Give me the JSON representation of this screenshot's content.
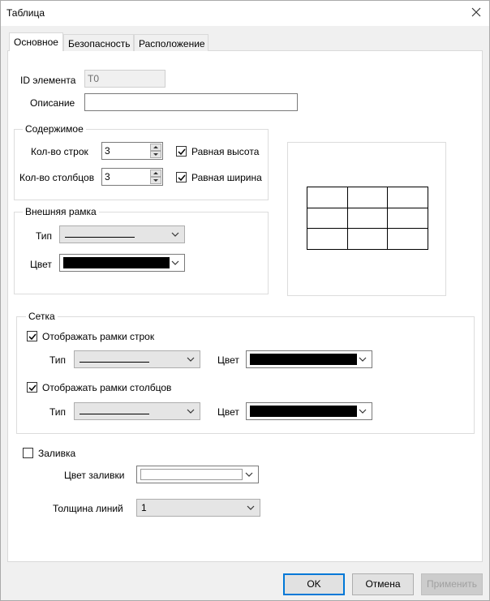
{
  "window": {
    "title": "Таблица"
  },
  "tabs": [
    {
      "label": "Основное",
      "active": true
    },
    {
      "label": "Безопасность",
      "active": false
    },
    {
      "label": "Расположение",
      "active": false
    }
  ],
  "element_id": {
    "label": "ID элемента",
    "value": "T0"
  },
  "description": {
    "label": "Описание",
    "value": ""
  },
  "content": {
    "legend": "Содержимое",
    "rows": {
      "label": "Кол-во строк",
      "value": "3"
    },
    "cols": {
      "label": "Кол-во столбцов",
      "value": "3"
    },
    "equal_height": {
      "label": "Равная высота",
      "checked": true
    },
    "equal_width": {
      "label": "Равная ширина",
      "checked": true
    }
  },
  "outer_frame": {
    "legend": "Внешняя рамка",
    "type_label": "Тип",
    "color_label": "Цвет",
    "color": "#000000"
  },
  "grid": {
    "legend": "Сетка",
    "show_row_borders": {
      "label": "Отображать рамки строк",
      "checked": true
    },
    "show_col_borders": {
      "label": "Отображать рамки столбцов",
      "checked": true
    },
    "type_label": "Тип",
    "color_label": "Цвет",
    "color": "#000000"
  },
  "fill": {
    "label": "Заливка",
    "checked": false,
    "color_label": "Цвет заливки",
    "color": "#ffffff"
  },
  "line_width": {
    "label": "Толщина линий",
    "value": "1"
  },
  "buttons": {
    "ok": "OK",
    "cancel": "Отмена",
    "apply": "Применить"
  }
}
